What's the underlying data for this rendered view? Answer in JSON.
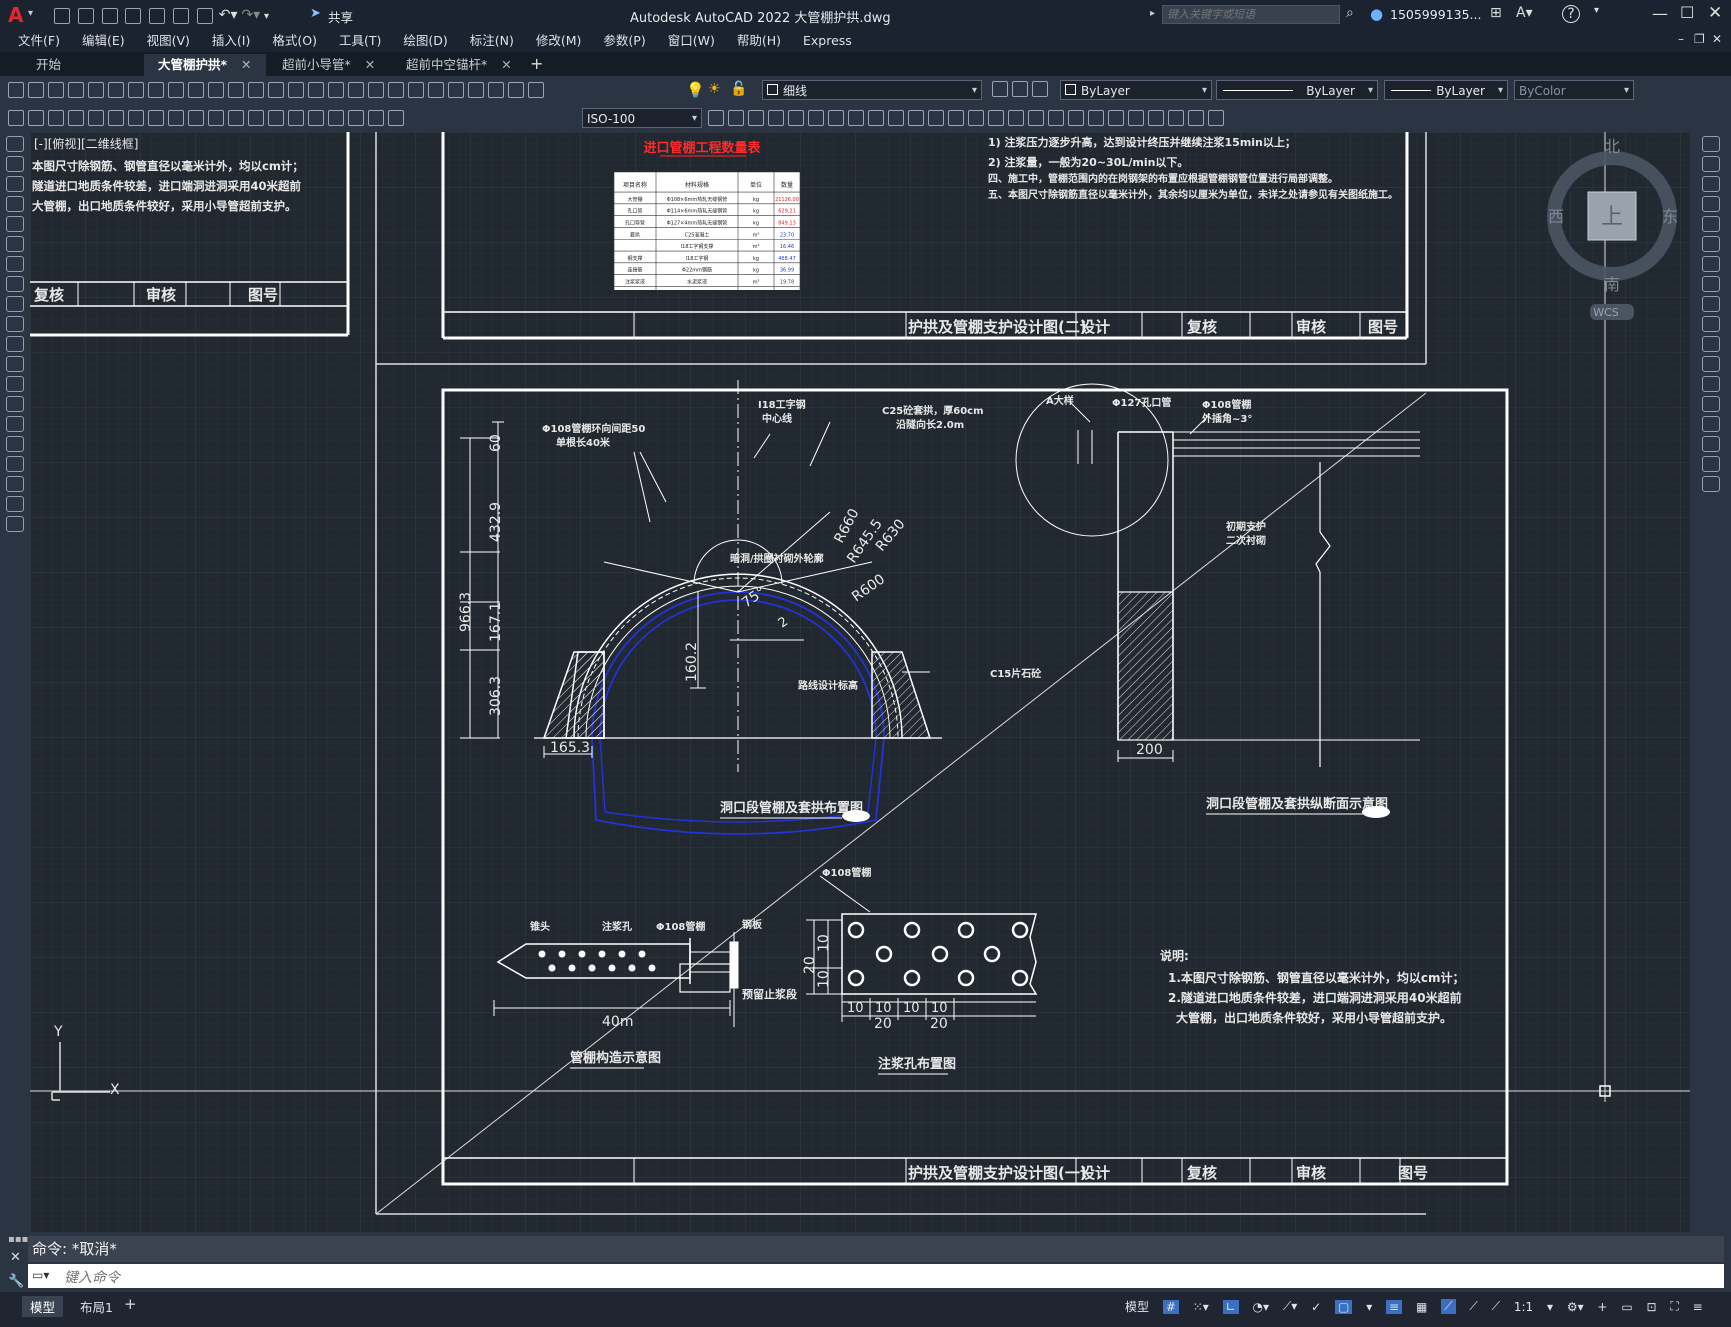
{
  "app": {
    "logo": "A",
    "window_title": "Autodesk AutoCAD 2022    大管棚护拱.dwg",
    "share_label": "共享",
    "search_placeholder": "键入关键字或短语",
    "user": "1505999135...",
    "help": "?"
  },
  "menu": [
    "文件(F)",
    "编辑(E)",
    "视图(V)",
    "插入(I)",
    "格式(O)",
    "工具(T)",
    "绘图(D)",
    "标注(N)",
    "修改(M)",
    "参数(P)",
    "窗口(W)",
    "帮助(H)",
    "Express"
  ],
  "tabs": [
    {
      "label": "开始",
      "active": false
    },
    {
      "label": "大管棚护拱*",
      "active": true
    },
    {
      "label": "超前小导管*",
      "active": false
    },
    {
      "label": "超前中空锚杆*",
      "active": false
    }
  ],
  "toolbar": {
    "layer": "细线",
    "color": "ByLayer",
    "linetype": "ByLayer",
    "lineweight": "ByLayer",
    "plotstyle": "ByColor",
    "dimstyle": "ISO-100"
  },
  "viewcube": {
    "north": "北",
    "south": "南",
    "east": "东",
    "west": "西",
    "top": "上",
    "wcs": "WCS"
  },
  "viewport_label": "[-][俯视][二维线框]",
  "drawing": {
    "top_left_notes": [
      "本图尺寸除钢筋、钢管直径以毫米计外，均以cm计；",
      "隧道进口地质条件较差，进口端洞进洞采用40米超前",
      "大管棚，出口地质条件较好，采用小导管超前支护。"
    ],
    "top_table_title": "进口管棚工程数量表",
    "top_table_headers": [
      "项目名称",
      "材料规格",
      "单位",
      "数量"
    ],
    "top_table_rows": [
      [
        "大管棚",
        "Φ108×6mm热轧无缝钢管",
        "kg",
        "21126.00"
      ],
      [
        "孔口管",
        "Φ114×6mm热轧无缝钢管",
        "kg",
        "629.21"
      ],
      [
        "孔口导管",
        "Φ127×4mm热轧无缝钢管",
        "kg",
        "849.13"
      ],
      [
        "套拱",
        "C25混凝土",
        "m³",
        "23.70"
      ],
      [
        "",
        "I18工字钢支撑",
        "m³",
        "16.46"
      ],
      [
        "钢支撑",
        "I18工字钢",
        "kg",
        "468.47"
      ],
      [
        "连接筋",
        "Φ22mm钢筋",
        "kg",
        "36.99"
      ],
      [
        "注浆浆液",
        "水泥浆液",
        "m³",
        "19.78"
      ]
    ],
    "top_right_notes": [
      "1) 注浆压力逐步升高，达到设计终压并继续注浆15min以上；",
      "2) 注浆量，一般为20~30L/min以下。",
      "四、施工中，管棚范围内的在岗钢架的布置应根据管棚钢管位置进行局部调整。",
      "五、本图尺寸除钢筋直径以毫米计外，其余均以厘米为单位，未详之处请参见有关图纸施工。"
    ],
    "sig_labels": [
      "复核",
      "审核",
      "图号",
      "设计"
    ],
    "sheet_title_2": "护拱及管棚支护设计图(二)",
    "sheet_title_1": "护拱及管棚支护设计图(一)",
    "main_notes_title": "说明:",
    "main_notes": [
      "1.本图尺寸除钢筋、钢管直径以毫米计外，均以cm计；",
      "2.隧道进口地质条件较差，进口端洞进洞采用40米超前",
      "大管棚，出口地质条件较好，采用小导管超前支护。"
    ],
    "arch_labels": {
      "pipe": "Φ108管棚环向间距50",
      "pipe2": "单根长40米",
      "ibeam": "I18工字钢",
      "center": "中心线",
      "c25": "C25砼套拱，厚60cm",
      "c25b": "沿隧向长2.0m",
      "contour": "暗洞/拱圈衬砌外轮廓",
      "design_elev": "路线设计标高",
      "c15": "C15片石砼",
      "r660": "R660",
      "r645": "R645.5",
      "r630": "R630",
      "r600": "R600",
      "angle": "75°",
      "d60": "60",
      "d432": "432.9",
      "d966": "966.3",
      "d167": "167.1",
      "d306": "306.3",
      "d160": "160.2",
      "d1653": "165.3",
      "d2": "2",
      "title": "洞口段管棚及套拱布置图"
    },
    "section_labels": {
      "a": "A大样",
      "pipe127": "Φ127孔口管",
      "pipe108": "Φ108管棚",
      "ext": "外插角~3°",
      "support1": "初期支护",
      "support2": "二次衬砌",
      "d200": "200",
      "title": "洞口段管棚及套拱纵断面示意图"
    },
    "pipe_labels": {
      "head": "锥头",
      "hole": "注浆孔",
      "pipe": "Φ108管棚",
      "plug": "钢板",
      "stop": "预留止浆段",
      "len": "40m",
      "title": "管棚构造示意图"
    },
    "hole_labels": {
      "pipe": "Φ108管棚",
      "d20": "20",
      "d10a": "10",
      "d10b": "10",
      "b10": [
        "10",
        "10",
        "10",
        "10"
      ],
      "b20": [
        "20",
        "20"
      ],
      "title": "注浆孔布置图"
    },
    "ucs_x": "X",
    "ucs_y": "Y"
  },
  "command": {
    "history": "命令: *取消*",
    "placeholder": "键入命令"
  },
  "layout_tabs": [
    "模型",
    "布局1"
  ],
  "status": {
    "model": "模型",
    "scale": "1:1"
  },
  "colors": {
    "bg": "#212830",
    "blue_line": "#2333d6",
    "red_text": "#ff2a2a"
  }
}
